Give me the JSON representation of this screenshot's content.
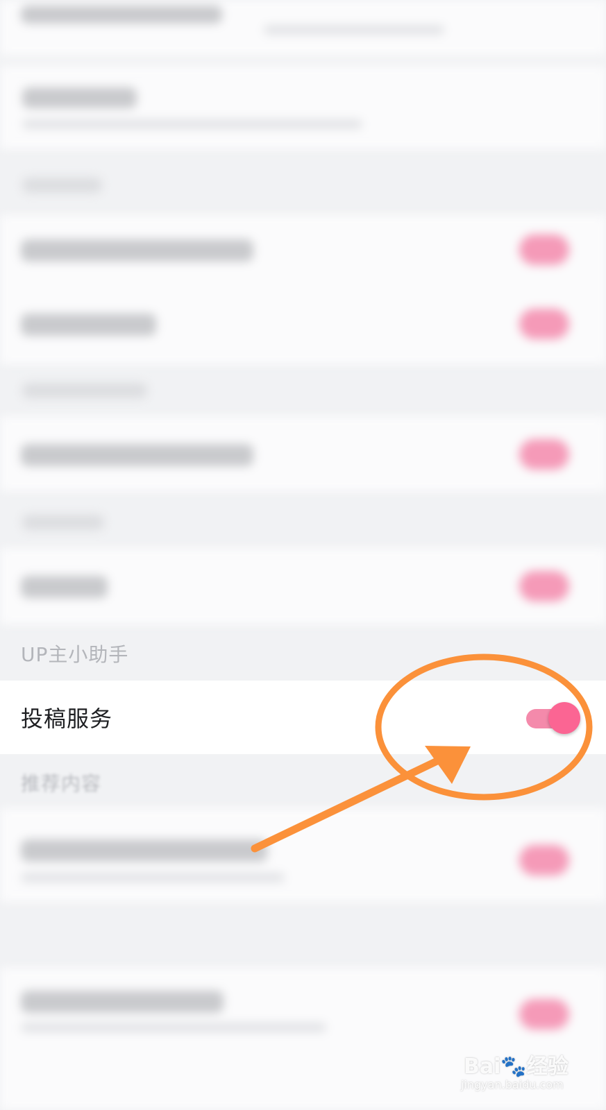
{
  "sections": {
    "up_assistant_label": "UP主小助手",
    "recommended_label": "推荐内容"
  },
  "focused_setting": {
    "label": "投稿服务",
    "switch_on": true
  },
  "colors": {
    "switch_knob": "#fb6593",
    "switch_track": "#f48aab",
    "annotation": "#fb913a",
    "background": "#f1f2f4"
  },
  "watermark": {
    "main": "Bai🐾经验",
    "sub": "jingyan.baidu.com"
  }
}
